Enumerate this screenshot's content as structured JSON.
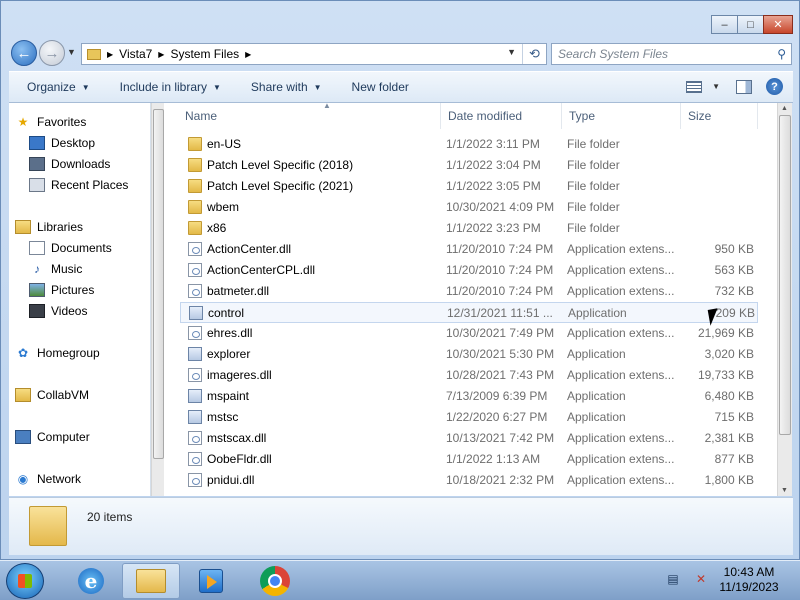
{
  "window": {
    "address": {
      "crumbs": [
        "Vista7",
        "System Files"
      ]
    },
    "search_placeholder": "Search System Files",
    "toolbar": {
      "organize": "Organize",
      "include_in_library": "Include in library",
      "share_with": "Share with",
      "new_folder": "New folder"
    },
    "caption": {
      "minimize": "–",
      "maximize": "□",
      "close": "✕"
    }
  },
  "nav_pane": {
    "favorites": {
      "label": "Favorites",
      "items": [
        "Desktop",
        "Downloads",
        "Recent Places"
      ]
    },
    "libraries": {
      "label": "Libraries",
      "items": [
        "Documents",
        "Music",
        "Pictures",
        "Videos"
      ]
    },
    "homegroup": "Homegroup",
    "collabvm": "CollabVM",
    "computer": "Computer",
    "network": "Network"
  },
  "columns": {
    "name": "Name",
    "date": "Date modified",
    "type": "Type",
    "size": "Size"
  },
  "files": [
    {
      "name": "en-US",
      "date": "1/1/2022 3:11 PM",
      "type": "File folder",
      "size": "",
      "icon": "folder-icon"
    },
    {
      "name": "Patch Level Specific (2018)",
      "date": "1/1/2022 3:04 PM",
      "type": "File folder",
      "size": "",
      "icon": "folder-icon"
    },
    {
      "name": "Patch Level Specific (2021)",
      "date": "1/1/2022 3:05 PM",
      "type": "File folder",
      "size": "",
      "icon": "folder-icon"
    },
    {
      "name": "wbem",
      "date": "10/30/2021 4:09 PM",
      "type": "File folder",
      "size": "",
      "icon": "folder-icon"
    },
    {
      "name": "x86",
      "date": "1/1/2022 3:23 PM",
      "type": "File folder",
      "size": "",
      "icon": "folder-icon"
    },
    {
      "name": "ActionCenter.dll",
      "date": "11/20/2010 7:24 PM",
      "type": "Application extens...",
      "size": "950 KB",
      "icon": "dll-icon"
    },
    {
      "name": "ActionCenterCPL.dll",
      "date": "11/20/2010 7:24 PM",
      "type": "Application extens...",
      "size": "563 KB",
      "icon": "dll-icon"
    },
    {
      "name": "batmeter.dll",
      "date": "11/20/2010 7:24 PM",
      "type": "Application extens...",
      "size": "732 KB",
      "icon": "dll-icon"
    },
    {
      "name": "control",
      "date": "12/31/2021 11:51 ...",
      "type": "Application",
      "size": "209 KB",
      "icon": "app-icon"
    },
    {
      "name": "ehres.dll",
      "date": "10/30/2021 7:49 PM",
      "type": "Application extens...",
      "size": "21,969 KB",
      "icon": "dll-icon"
    },
    {
      "name": "explorer",
      "date": "10/30/2021 5:30 PM",
      "type": "Application",
      "size": "3,020 KB",
      "icon": "app-icon"
    },
    {
      "name": "imageres.dll",
      "date": "10/28/2021 7:43 PM",
      "type": "Application extens...",
      "size": "19,733 KB",
      "icon": "dll-icon"
    },
    {
      "name": "mspaint",
      "date": "7/13/2009 6:39 PM",
      "type": "Application",
      "size": "6,480 KB",
      "icon": "app-icon"
    },
    {
      "name": "mstsc",
      "date": "1/22/2020 6:27 PM",
      "type": "Application",
      "size": "715 KB",
      "icon": "app-icon"
    },
    {
      "name": "mstscax.dll",
      "date": "10/13/2021 7:42 PM",
      "type": "Application extens...",
      "size": "2,381 KB",
      "icon": "dll-icon"
    },
    {
      "name": "OobeFldr.dll",
      "date": "1/1/2022 1:13 AM",
      "type": "Application extens...",
      "size": "877 KB",
      "icon": "dll-icon"
    },
    {
      "name": "pnidui.dll",
      "date": "10/18/2021 2:32 PM",
      "type": "Application extens...",
      "size": "1,800 KB",
      "icon": "dll-icon"
    }
  ],
  "details": {
    "count": "20 items"
  },
  "taskbar": {
    "time": "10:43 AM",
    "date": "11/19/2023"
  }
}
